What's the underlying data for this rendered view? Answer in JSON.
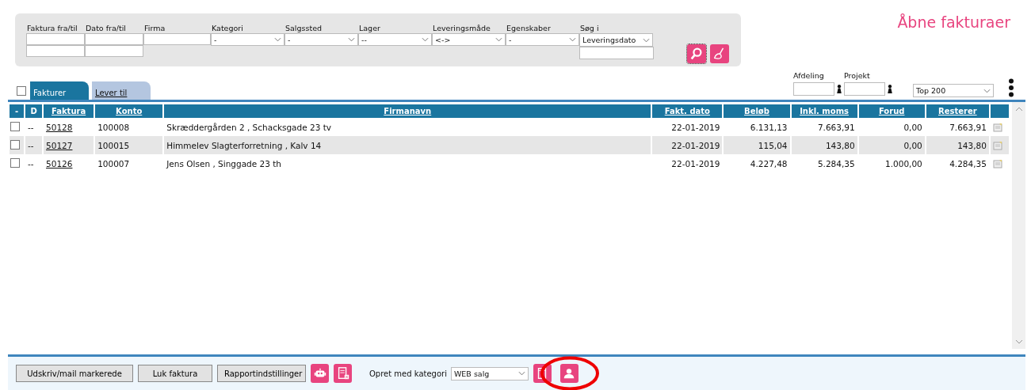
{
  "page_title": "Åbne fakturaer",
  "filters": [
    {
      "label": "Faktura fra/til",
      "kind": "range"
    },
    {
      "label": "Dato fra/til",
      "kind": "range"
    },
    {
      "label": "Firma",
      "kind": "text"
    },
    {
      "label": "Kategori",
      "kind": "select",
      "value": "-"
    },
    {
      "label": "Salgssted",
      "kind": "select",
      "value": "-"
    },
    {
      "label": "Lager",
      "kind": "select",
      "value": "--"
    },
    {
      "label": "Leveringsmåde",
      "kind": "select",
      "value": "<->"
    },
    {
      "label": "Egenskaber",
      "kind": "select",
      "value": "-"
    },
    {
      "label": "Søg i",
      "kind": "select_text",
      "value": "Leveringsdato"
    }
  ],
  "select_all": {
    "checked": false
  },
  "tabs": [
    {
      "label": "Fakturer",
      "selected": true
    },
    {
      "label": "Lever til",
      "selected": false
    }
  ],
  "afdeling": {
    "label": "Afdeling"
  },
  "projekt": {
    "label": "Projekt"
  },
  "limit_select": {
    "value": "Top 200"
  },
  "table": {
    "columns": [
      "-",
      "D",
      "Faktura",
      "Konto",
      "Firmanavn",
      "Fakt. dato",
      "Beløb",
      "Inkl. moms",
      "Forud",
      "Resterer"
    ],
    "rows": [
      {
        "checked": false,
        "d": "--",
        "faktura": "50128",
        "konto": "100008",
        "firmanavn": "Skræddergården 2 , Schacksgade 23 tv",
        "dato": "22-01-2019",
        "belob": "6.131,13",
        "inkl": "7.663,91",
        "forud": "0,00",
        "resterer": "7.663,91"
      },
      {
        "checked": false,
        "d": "--",
        "faktura": "50127",
        "konto": "100015",
        "firmanavn": "Himmelev Slagterforretning , Kalv 14",
        "dato": "22-01-2019",
        "belob": "115,04",
        "inkl": "143,80",
        "forud": "0,00",
        "resterer": "143,80"
      },
      {
        "checked": false,
        "d": "--",
        "faktura": "50126",
        "konto": "100007",
        "firmanavn": "Jens Olsen , Singgade 23 th",
        "dato": "22-01-2019",
        "belob": "4.227,48",
        "inkl": "5.284,35",
        "forud": "1.000,00",
        "resterer": "4.284,35"
      }
    ]
  },
  "footer": {
    "buttons": [
      "Udskriv/mail markerede",
      "Luk faktura",
      "Rapportindstillinger"
    ],
    "category_label": "Opret med kategori",
    "category_value": "WEB salg"
  }
}
